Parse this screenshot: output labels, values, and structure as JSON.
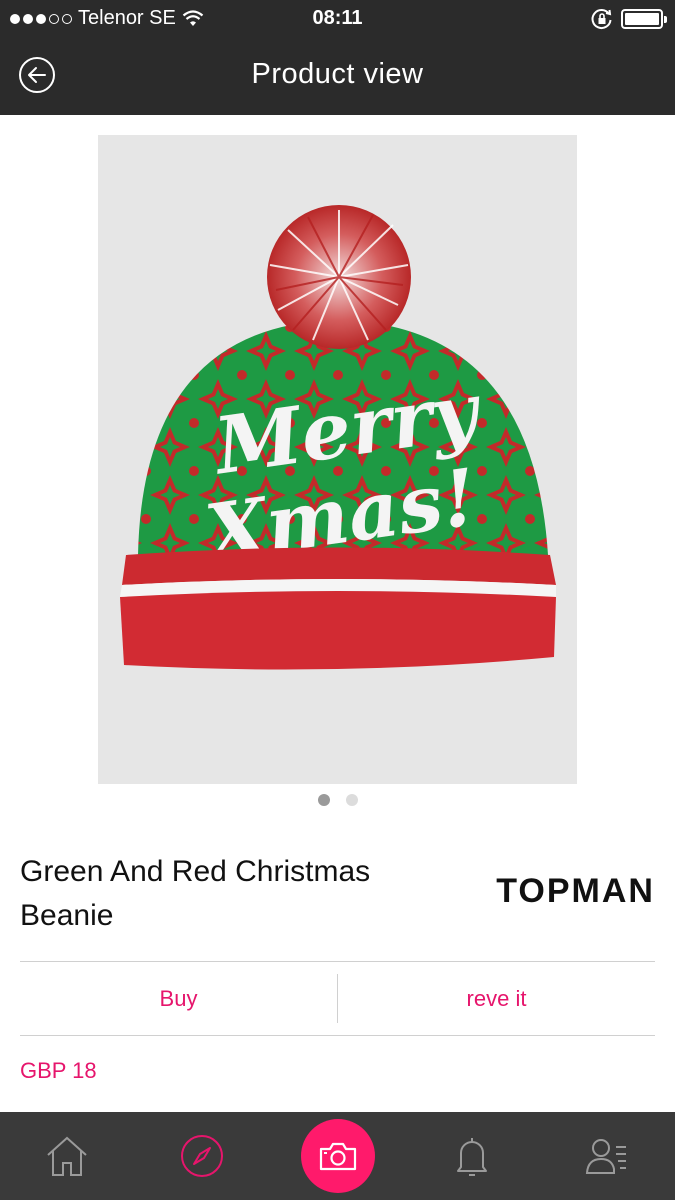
{
  "status_bar": {
    "carrier": "Telenor SE",
    "time": "08:11",
    "signal_dots_filled": 3,
    "signal_dots_total": 5
  },
  "nav": {
    "title": "Product view",
    "back_icon": "back-arrow-circle-icon"
  },
  "product": {
    "image": {
      "description_icon": "beanie-hat-image",
      "text_on_hat": "Merry Xmas!"
    },
    "image_pager": {
      "count": 2,
      "active_index": 0
    },
    "name": "Green And Red Christmas Beanie",
    "brand": "TOPMAN",
    "price": "GBP 18"
  },
  "actions": {
    "buy_label": "Buy",
    "reve_label": "reve it"
  },
  "tab_bar": {
    "items": [
      {
        "name": "home",
        "icon": "home-icon"
      },
      {
        "name": "discover",
        "icon": "compass-icon"
      },
      {
        "name": "camera",
        "icon": "camera-icon"
      },
      {
        "name": "notifications",
        "icon": "bell-icon"
      },
      {
        "name": "profile",
        "icon": "profile-list-icon"
      }
    ]
  },
  "colors": {
    "accent": "#e6156c",
    "camera_button": "#ff1a6b",
    "bars": "#2b2b2b",
    "tabbar": "#3a3a3a"
  }
}
